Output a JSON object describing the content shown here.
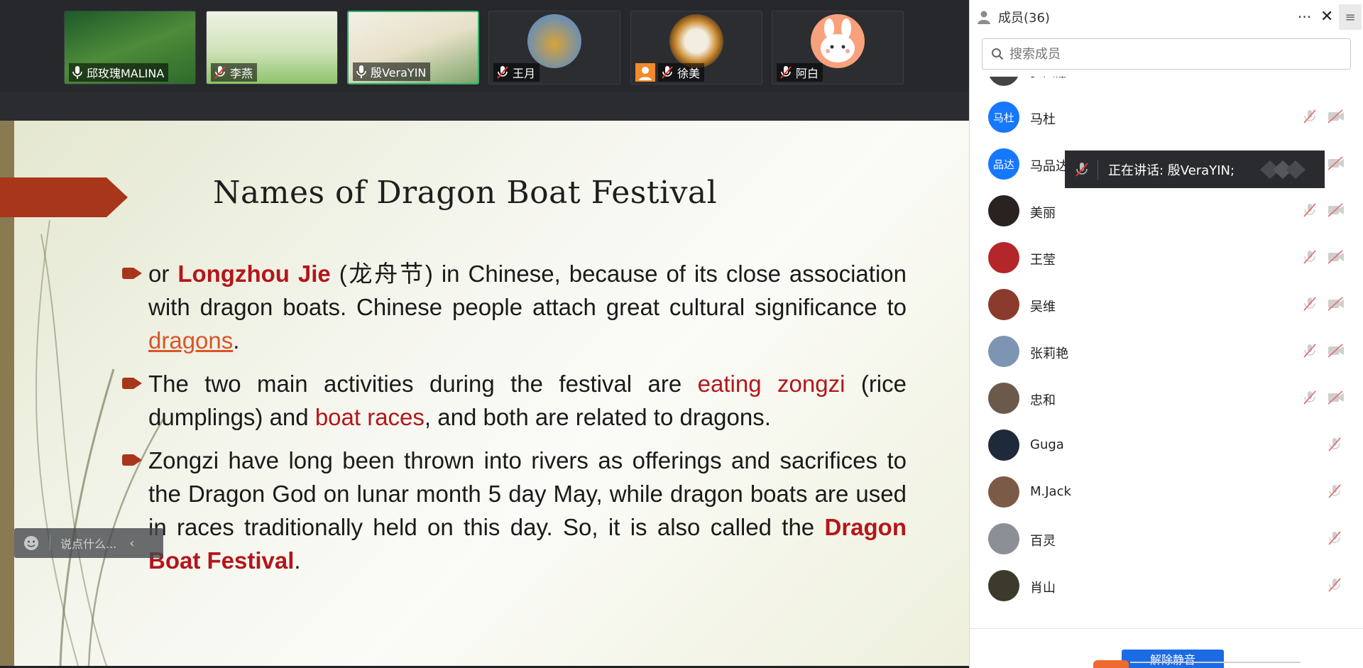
{
  "video_tiles": [
    {
      "name": "邱玫瑰MALINA",
      "active": false
    },
    {
      "name": "李燕",
      "active": false
    },
    {
      "name": "殷VeraYIN",
      "active": true
    },
    {
      "name": "王月",
      "active": false
    },
    {
      "name": "徐美",
      "active": false
    },
    {
      "name": "阿白",
      "active": false
    }
  ],
  "slide": {
    "title": "Names of Dragon Boat Festival",
    "b1": {
      "p1": "or ",
      "term": "Longzhou Jie",
      "p2": " (龙舟节) in Chinese, because of its close association with dragon boats. Chinese people attach great cultural significance to ",
      "link": "dragons",
      "p3": "."
    },
    "b2": {
      "p1": "The two main activities during the festival are ",
      "r1": "eating zongzi",
      "p2": " (rice dumplings) and ",
      "r2": "boat races",
      "p3": ", and both are related to dragons."
    },
    "b3": {
      "p1": "Zongzi have long been thrown into rivers as offerings and sacrifices to the Dragon God on lunar month 5 day May, while dragon boats are used in races traditionally held on this day. So, it is also called the ",
      "term": "Dragon Boat Festival",
      "p2": "."
    }
  },
  "chat": {
    "placeholder": "说点什么..."
  },
  "panel": {
    "title": "成员(36)",
    "more": "···",
    "close": "✕",
    "menu": "≡",
    "search_placeholder": "搜索成员",
    "members": [
      {
        "name": "罗四娜",
        "initials": "",
        "avatar_color": "#444444",
        "cam": true
      },
      {
        "name": "马杜",
        "initials": "马杜",
        "avatar_color": "#1677ff",
        "cam": true
      },
      {
        "name": "马品达",
        "initials": "品达",
        "avatar_color": "#1677ff",
        "cam": true
      },
      {
        "name": "美丽",
        "initials": "",
        "avatar_color": "#2a2220",
        "cam": true
      },
      {
        "name": "王莹",
        "initials": "",
        "avatar_color": "#b3262a",
        "cam": true
      },
      {
        "name": "吴维",
        "initials": "",
        "avatar_color": "#8a3b2e",
        "cam": true
      },
      {
        "name": "张莉艳",
        "initials": "",
        "avatar_color": "#7d95b3",
        "cam": true
      },
      {
        "name": "忠和",
        "initials": "",
        "avatar_color": "#6b5a4c",
        "cam": true
      },
      {
        "name": "Guga",
        "initials": "",
        "avatar_color": "#1e2a3a",
        "cam": false
      },
      {
        "name": "M.Jack",
        "initials": "",
        "avatar_color": "#7c5a48",
        "cam": false
      },
      {
        "name": "百灵",
        "initials": "",
        "avatar_color": "#8d8f96",
        "cam": false
      },
      {
        "name": "肖山",
        "initials": "",
        "avatar_color": "#3c3a2a",
        "cam": false
      }
    ],
    "speaking": "正在讲话: 殷VeraYIN;",
    "unmute": "解除静音"
  }
}
